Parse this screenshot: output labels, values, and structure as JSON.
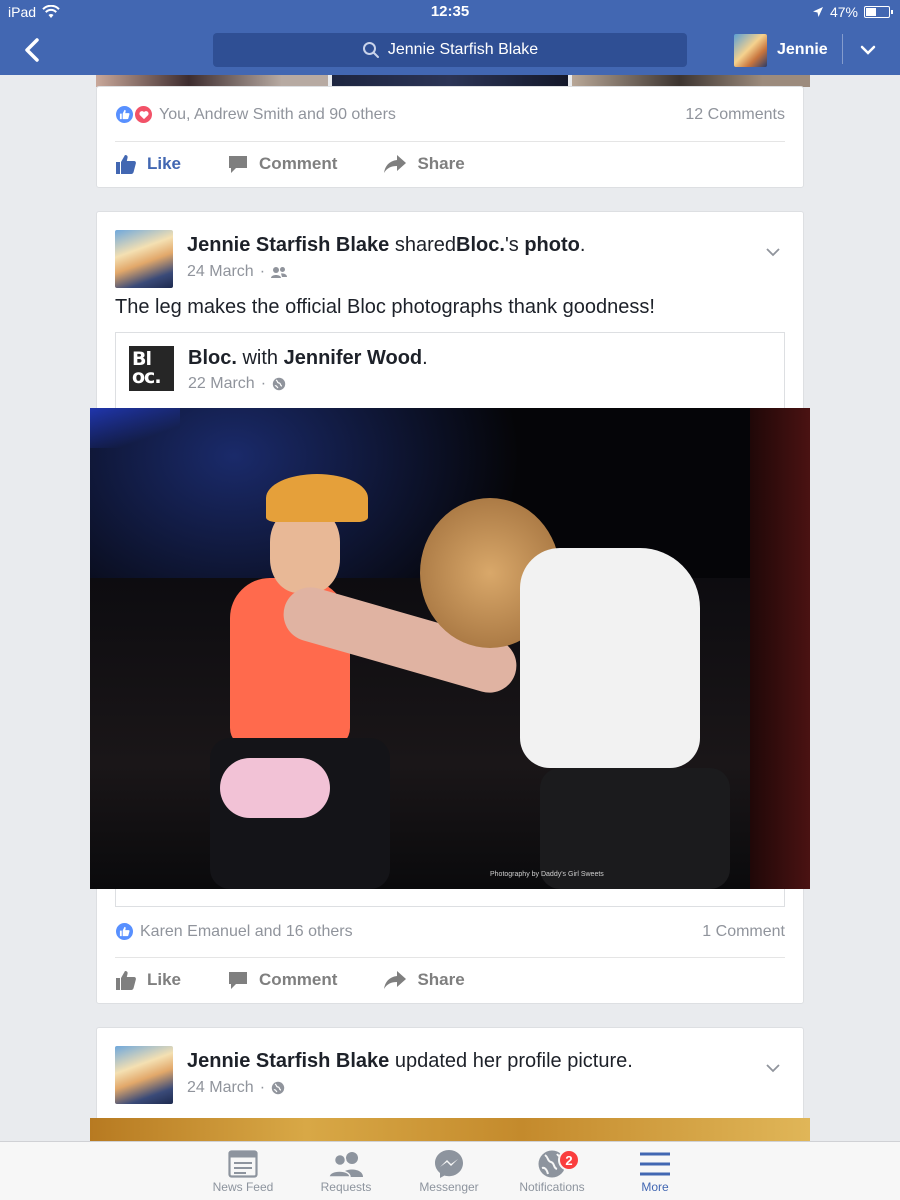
{
  "status_bar": {
    "device": "iPad",
    "time": "12:35",
    "battery": "47%",
    "battery_level": 0.47
  },
  "nav": {
    "search_text": "Jennie Starfish Blake",
    "profile_name": "Jennie"
  },
  "post1": {
    "reactions_text": "You, Andrew Smith and 90 others",
    "comments_count": "12 Comments",
    "actions": {
      "like": "Like",
      "comment": "Comment",
      "share": "Share"
    }
  },
  "post2": {
    "author": "Jennie Starfish Blake",
    "verb": "shared",
    "source": "Bloc.",
    "possessive": "'s",
    "object": "photo",
    "period": ".",
    "date": "24 March",
    "text": "The leg makes the official Bloc photographs thank goodness!",
    "shared": {
      "logo_line1": "Bl",
      "logo_line2": "oc.",
      "page": "Bloc.",
      "with": "with",
      "tagged": "Jennifer Wood",
      "period": ".",
      "date": "22 March",
      "photo_credit": "Photography by Daddy's Girl Sweets"
    },
    "reactions_text": "Karen Emanuel and 16 others",
    "comments_count": "1 Comment",
    "actions": {
      "like": "Like",
      "comment": "Comment",
      "share": "Share"
    }
  },
  "post3": {
    "author": "Jennie Starfish Blake",
    "rest": "updated her profile picture.",
    "date": "24 March"
  },
  "tabbar": {
    "items": [
      {
        "label": "News Feed",
        "icon": "news-feed-icon"
      },
      {
        "label": "Requests",
        "icon": "friend-requests-icon"
      },
      {
        "label": "Messenger",
        "icon": "messenger-icon"
      },
      {
        "label": "Notifications",
        "icon": "globe-icon",
        "badge": "2"
      },
      {
        "label": "More",
        "icon": "menu-icon",
        "active": true
      }
    ]
  },
  "colors": {
    "brand": "#4267b2",
    "like_blue": "#5890ff",
    "love_red": "#f25268",
    "badge_red": "#fa3e3e"
  }
}
